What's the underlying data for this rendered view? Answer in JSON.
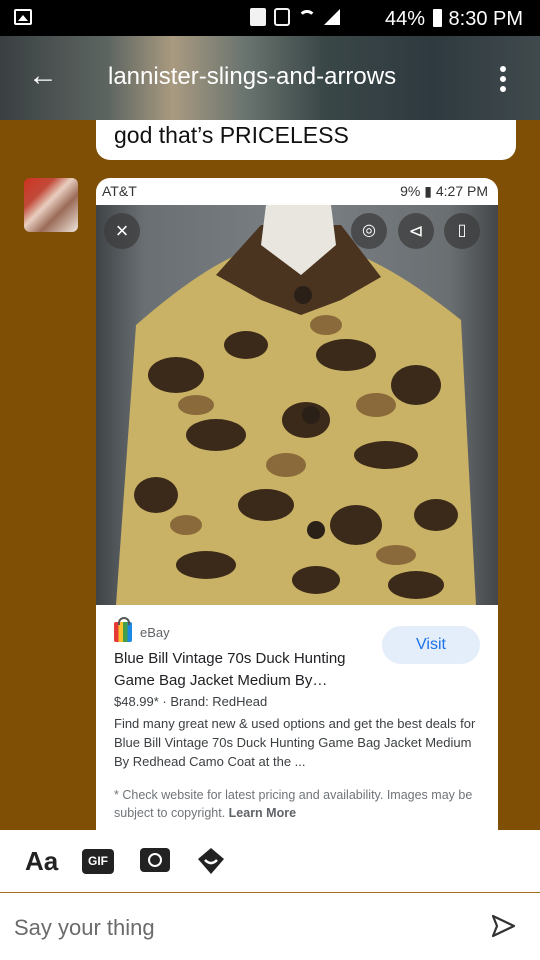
{
  "status_bar": {
    "battery": "44%",
    "time": "8:30 PM"
  },
  "header": {
    "title": "lannister-slings-and-arrows"
  },
  "previous_message": {
    "text": "god that’s PRICELESS"
  },
  "card": {
    "inner_status": {
      "carrier": "AT&T",
      "right": "9% ▮ 4:27 PM"
    },
    "source": "eBay",
    "visit_label": "Visit",
    "product_title": "Blue Bill Vintage 70s Duck Hunting Game Bag Jacket Medium By…",
    "price_line": "$48.99*  ·  Brand: RedHead",
    "description": "Find many great new & used options and get the best deals for Blue Bill Vintage 70s Duck Hunting Game Bag Jacket Medium By Redhead Camo Coat at the ...",
    "disclaimer": "* Check website for latest pricing and availability. Images may be subject to copyright.",
    "learn_more": "Learn More"
  },
  "toolbar": {
    "text_style": "Aa",
    "gif": "GIF"
  },
  "composer": {
    "placeholder": "Say your thing"
  }
}
